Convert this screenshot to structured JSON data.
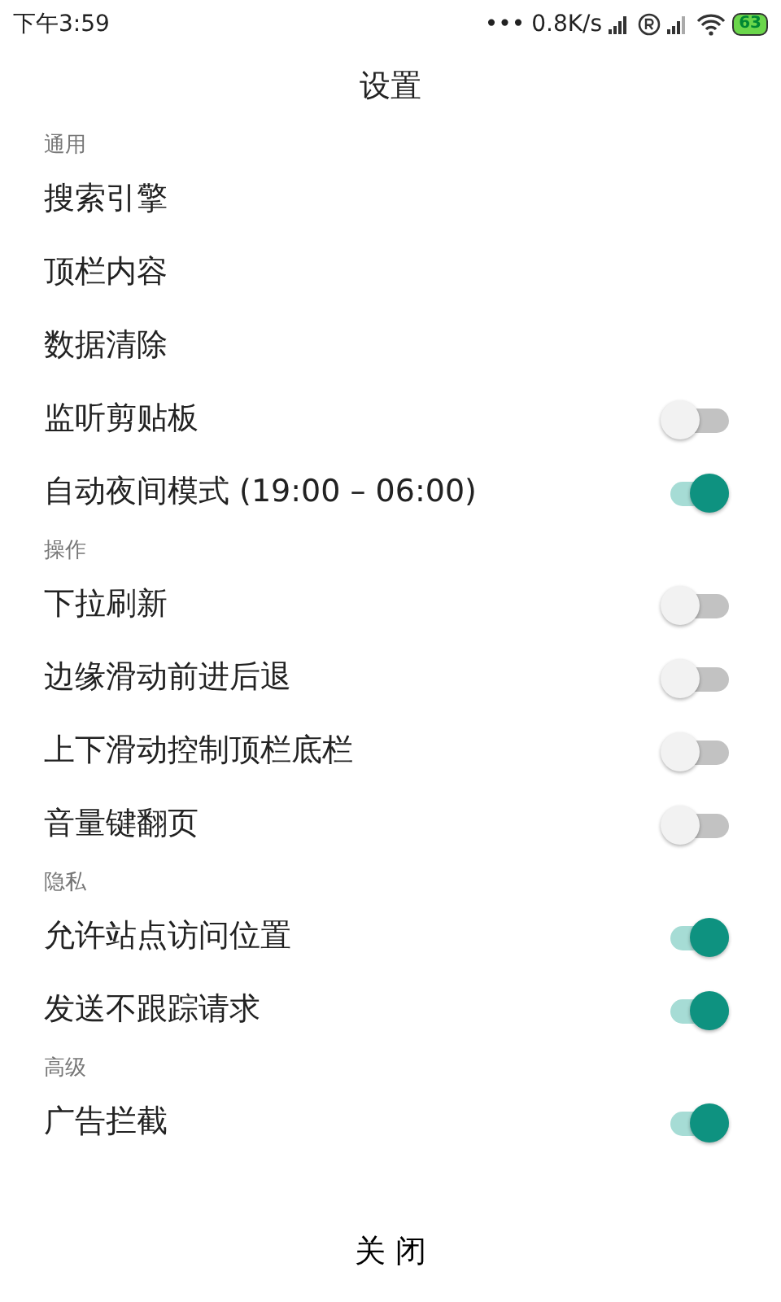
{
  "status_bar": {
    "time": "下午3:59",
    "dots": "•••",
    "speed": "0.8K/s",
    "battery": "63"
  },
  "title": "设置",
  "sections": [
    {
      "header": "通用",
      "items": [
        {
          "label": "搜索引擎",
          "kind": "link"
        },
        {
          "label": "顶栏内容",
          "kind": "link"
        },
        {
          "label": "数据清除",
          "kind": "link"
        },
        {
          "label": "监听剪贴板",
          "kind": "toggle",
          "on": false
        },
        {
          "label": "自动夜间模式 (19:00 – 06:00)",
          "kind": "toggle",
          "on": true
        }
      ]
    },
    {
      "header": "操作",
      "items": [
        {
          "label": "下拉刷新",
          "kind": "toggle",
          "on": false
        },
        {
          "label": "边缘滑动前进后退",
          "kind": "toggle",
          "on": false
        },
        {
          "label": "上下滑动控制顶栏底栏",
          "kind": "toggle",
          "on": false
        },
        {
          "label": "音量键翻页",
          "kind": "toggle",
          "on": false
        }
      ]
    },
    {
      "header": "隐私",
      "items": [
        {
          "label": "允许站点访问位置",
          "kind": "toggle",
          "on": true
        },
        {
          "label": "发送不跟踪请求",
          "kind": "toggle",
          "on": true
        }
      ]
    },
    {
      "header": "高级",
      "items": [
        {
          "label": "广告拦截",
          "kind": "toggle",
          "on": true
        }
      ]
    }
  ],
  "close_button": "关 闭"
}
